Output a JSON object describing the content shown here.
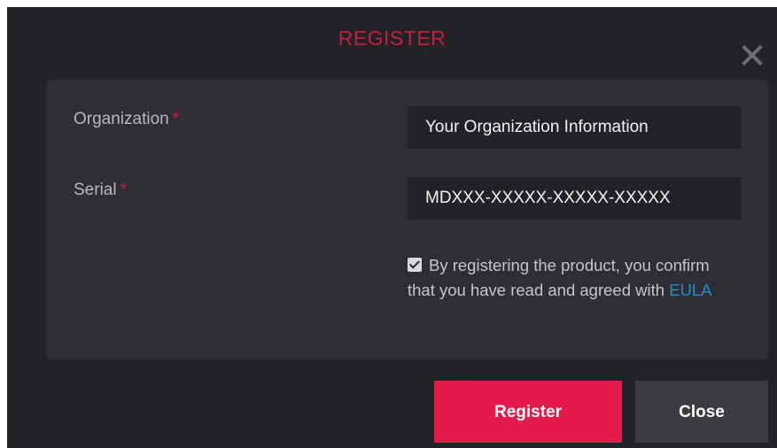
{
  "dialog": {
    "title": "REGISTER",
    "close_icon": "close-icon"
  },
  "form": {
    "organization": {
      "label": "Organization",
      "required_mark": "*",
      "value": "Your Organization Information"
    },
    "serial": {
      "label": "Serial",
      "required_mark": "*",
      "value": "MDXXX-XXXXX-XXXXX-XXXXX"
    },
    "consent": {
      "checked": true,
      "text": "By registering the product, you confirm that you have read and agreed with",
      "link_text": "EULA"
    }
  },
  "buttons": {
    "register_label": "Register",
    "close_label": "Close"
  },
  "colors": {
    "background": "#232327",
    "panel": "#2e2e33",
    "accent": "#e31b4b",
    "title": "#c2203f",
    "link": "#1f8fd0"
  }
}
